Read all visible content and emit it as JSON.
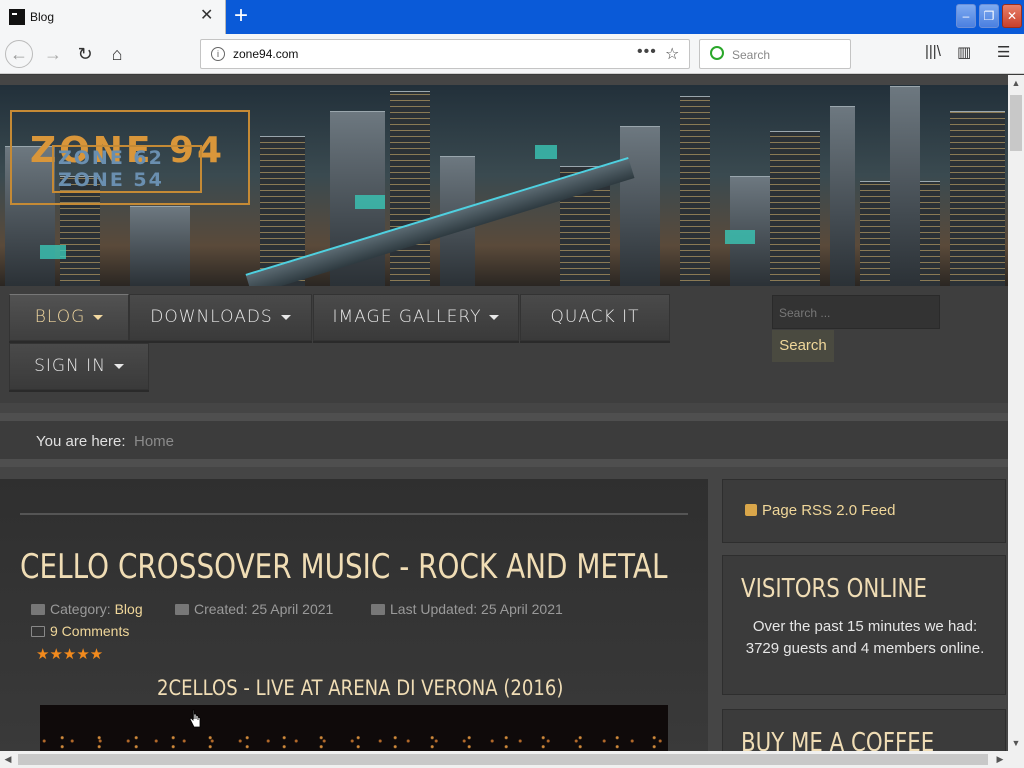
{
  "browser": {
    "tab_title": "Blog",
    "tab_close": "✕",
    "new_tab": "+",
    "url": "zone94.com",
    "url_actions": "•••",
    "bookmark_star": "☆",
    "search_placeholder": "Search",
    "back": "←",
    "forward": "→",
    "reload": "↻",
    "home": "⌂",
    "library": "|||\\",
    "sidebar_toggle": "▥",
    "menu": "☰",
    "minimize": "–",
    "restore": "❐",
    "close": "✕"
  },
  "site": {
    "logo_main": "ZONE 94",
    "logo_sub1": "ZONE 62",
    "logo_sub2": "ZONE 54",
    "menu": [
      {
        "label": "BLOG"
      },
      {
        "label": "DOWNLOADS"
      },
      {
        "label": "IMAGE GALLERY"
      },
      {
        "label": "QUACK IT"
      },
      {
        "label": "SIGN IN"
      }
    ],
    "search_placeholder": "Search ...",
    "search_button": "Search",
    "breadcrumb_label": "You are here:",
    "breadcrumb_home": "Home"
  },
  "article": {
    "title": "CELLO CROSSOVER MUSIC - ROCK AND METAL",
    "category_label": "Category:",
    "category": "Blog",
    "created": "Created: 25 April 2021",
    "updated": "Last Updated: 25 April 2021",
    "comments": "9 Comments",
    "rating_stars": "★★★★★",
    "subheading": "2CELLOS - LIVE AT ARENA DI VERONA (2016)"
  },
  "sidebar": {
    "rss": "Page RSS 2.0 Feed",
    "visitors_title": "VISITORS ONLINE",
    "visitors_text": "Over the past 15 minutes we had: 3729 guests and 4 members online.",
    "coffee_title": "BUY ME A COFFEE"
  },
  "colors": {
    "accent": "#f0d79a",
    "heading": "#f0ddb5",
    "star": "#f28a1d",
    "titlebar": "#0a5ad8"
  }
}
